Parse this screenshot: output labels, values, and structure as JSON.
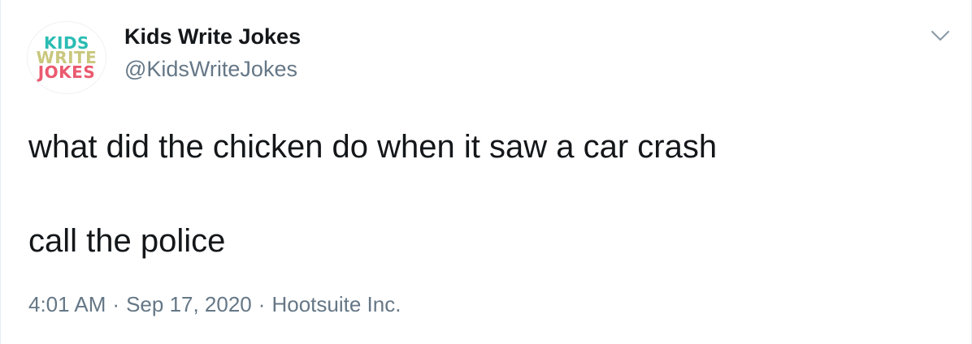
{
  "author": {
    "avatar_logo": {
      "lines": [
        "KIDS",
        "WRITE",
        "JOKES"
      ],
      "colors": [
        "#2bbcb3",
        "#c9c77d",
        "#ea5a6f"
      ]
    },
    "display_name": "Kids Write Jokes",
    "handle": "@KidsWriteJokes"
  },
  "tweet": {
    "lines": [
      "what did the chicken do when it saw a car crash",
      "",
      "call the police"
    ],
    "time": "4:01 AM",
    "date": "Sep 17, 2020",
    "source": "Hootsuite Inc.",
    "separator": "·"
  },
  "icons": {
    "menu": "chevron-down-icon"
  },
  "colors": {
    "text_primary": "#14171a",
    "text_secondary": "#657786",
    "caret": "#657786",
    "border": "#e6ecf0"
  }
}
